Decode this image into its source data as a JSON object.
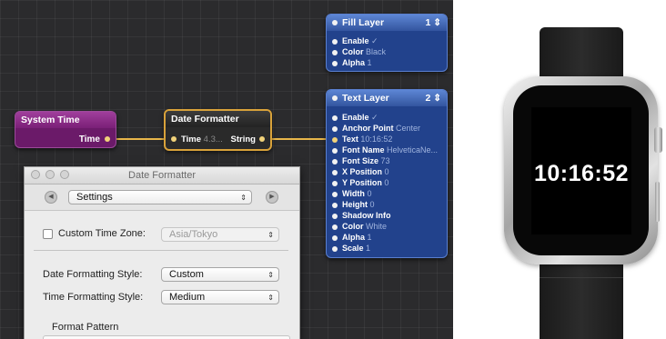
{
  "editor": {
    "nodes": {
      "system_time": {
        "title": "System Time",
        "output": "Time"
      },
      "date_formatter": {
        "title": "Date Formatter",
        "input_label": "Time",
        "input_value": "4.3...",
        "output": "String"
      },
      "fill_layer": {
        "title": "Fill Layer",
        "index": "1 ⇕",
        "rows": [
          {
            "name": "Enable",
            "value": "✓"
          },
          {
            "name": "Color",
            "value": "Black"
          },
          {
            "name": "Alpha",
            "value": "1"
          }
        ]
      },
      "text_layer": {
        "title": "Text Layer",
        "index": "2 ⇕",
        "rows": [
          {
            "name": "Enable",
            "value": "✓"
          },
          {
            "name": "Anchor Point",
            "value": "Center"
          },
          {
            "name": "Text",
            "value": "10:16:52"
          },
          {
            "name": "Font Name",
            "value": "HelveticaNe..."
          },
          {
            "name": "Font Size",
            "value": "73"
          },
          {
            "name": "X Position",
            "value": "0"
          },
          {
            "name": "Y Position",
            "value": "0"
          },
          {
            "name": "Width",
            "value": "0"
          },
          {
            "name": "Height",
            "value": "0"
          },
          {
            "name": "Shadow Info",
            "value": ""
          },
          {
            "name": "Color",
            "value": "White"
          },
          {
            "name": "Alpha",
            "value": "1"
          },
          {
            "name": "Scale",
            "value": "1"
          }
        ]
      }
    },
    "wire_color": "#e8b64a"
  },
  "inspector": {
    "title": "Date Formatter",
    "section_select": "Settings",
    "custom_time_zone_label": "Custom Time Zone:",
    "custom_time_zone_value": "Asia/Tokyo",
    "date_style_label": "Date Formatting Style:",
    "date_style_value": "Custom",
    "time_style_label": "Time Formatting Style:",
    "time_style_value": "Medium",
    "format_pattern_label": "Format Pattern"
  },
  "preview": {
    "time": "10:16:52"
  },
  "icons": {
    "select_arrows": "⇕",
    "nav_prev": "◀",
    "nav_next": "▶"
  }
}
